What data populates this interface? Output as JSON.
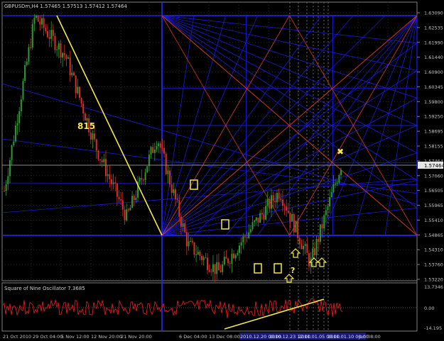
{
  "main": {
    "title": "GBPUSDm,H4  1.57465 1.57513 1.57412 1.57464",
    "price_axis": [
      "1.63090",
      "1.62535",
      "1.61990",
      "1.61440",
      "1.60900",
      "1.60345",
      "1.59800",
      "1.59250",
      "1.58695",
      "1.58155",
      "1.57464",
      "1.57060",
      "1.56505",
      "1.55965",
      "1.55410",
      "1.54865",
      "1.54310",
      "1.53760",
      "1.53220"
    ],
    "current_price": "1.57464",
    "annotations": {
      "swing_count": "815",
      "question": "?",
      "exit_marker": "✖"
    }
  },
  "oscillator": {
    "title": "Square of Nine Oscillator 7.3685",
    "scale": [
      "13.7346",
      "0.00",
      "-14.195"
    ]
  },
  "time_axis": [
    "21 Oct 2010",
    "29 Oct 04:00",
    "5 Nov 12:00",
    "12 Nov 20:00",
    "21 Nov 20:00",
    "6 Dec 04:00",
    "13 Dec 08:00",
    "2010.12.20 00:00",
    "2010.12.23 12:00",
    "2011.01.05 00:00",
    "2011.01.10 00:00",
    "Jan 08:00"
  ],
  "colors": {
    "background": "#000000",
    "grid_blue": "#1a1ad8",
    "fan_red": "#cc3b1a",
    "trend_yellow": "#f2e84a",
    "bull_candle": "#2f9a2f",
    "bear_candle": "#d83028",
    "oscillator_line": "#e01a1a",
    "axis_text": "#c0c0c0"
  },
  "chart_data": [
    {
      "type": "candlestick",
      "title": "GBPUSDm,H4",
      "ylim": [
        1.5322,
        1.6309
      ],
      "last_price": 1.57464,
      "swings": [
        {
          "label": "21 Oct 2010",
          "high": 1.5785,
          "low": 1.564
        },
        {
          "label": "29 Oct 04:00",
          "high": 1.63,
          "low": 1.595
        },
        {
          "label": "5 Nov 12:00",
          "high": 1.617,
          "low": 1.602
        },
        {
          "label": "12 Nov 20:00",
          "high": 1.601,
          "low": 1.58
        },
        {
          "label": "21 Nov 20:00",
          "high": 1.579,
          "low": 1.555
        },
        {
          "label": "6 Dec 04:00",
          "high": 1.587,
          "low": 1.566
        },
        {
          "label": "13 Dec 08:00",
          "high": 1.564,
          "low": 1.544
        },
        {
          "label": "2010.12.20 00:00",
          "high": 1.547,
          "low": 1.533
        },
        {
          "label": "2010.12.23 12:00",
          "high": 1.552,
          "low": 1.536
        },
        {
          "label": "2011.01.05 00:00",
          "high": 1.567,
          "low": 1.54
        },
        {
          "label": "2011.01.10 00:00",
          "high": 1.554,
          "low": 1.537
        },
        {
          "label": "Jan 08:00",
          "high": 1.577,
          "low": 1.556
        }
      ]
    },
    {
      "type": "line",
      "title": "Square of Nine Oscillator 7.3685",
      "ylim": [
        -14.195,
        13.7346
      ],
      "range_shown": [
        -14.195,
        13.7346
      ]
    }
  ]
}
